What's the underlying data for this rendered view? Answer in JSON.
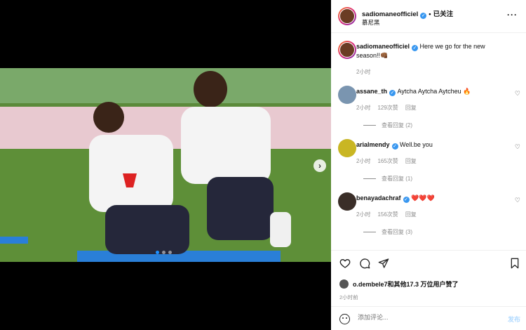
{
  "header": {
    "username": "sadiomaneofficiel",
    "separator": "•",
    "follow_label": "已关注",
    "location": "慕尼黑",
    "more_icon": "more-horizontal-icon"
  },
  "caption": {
    "username": "sadiomaneofficiel",
    "text": "Here we go for the new season!!👊🏾",
    "time": "2小时"
  },
  "comments": [
    {
      "username": "assane_th",
      "text": "Aytcha Aytcha Aytcheu 🔥",
      "time": "2小时",
      "likes": "129次赞",
      "reply": "回复",
      "view_replies": "查看回复 (2)"
    },
    {
      "username": "arialmendy",
      "text": "Well.be you",
      "time": "2小时",
      "likes": "165次赞",
      "reply": "回复",
      "view_replies": "查看回复 (1)"
    },
    {
      "username": "benayadachraf",
      "text": "❤️❤️❤️",
      "time": "2小时",
      "likes": "156次赞",
      "reply": "回复",
      "view_replies": "查看回复 (3)"
    }
  ],
  "actions": {
    "likes_text": "o.dembele7和其他17.3 万位用户赞了",
    "time": "2小时前"
  },
  "add_comment": {
    "placeholder": "添加评论...",
    "post_label": "发布"
  },
  "colors": {
    "accent": "#0095f6",
    "verified": "#3897f0",
    "muted": "#8e8e8e"
  }
}
